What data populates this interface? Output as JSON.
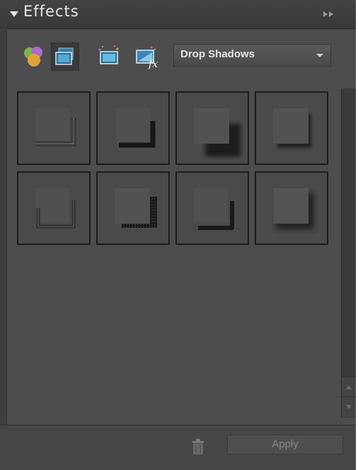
{
  "panel": {
    "title": "Effects",
    "collapse_icon": "double-chevron-right-icon"
  },
  "toolbar": {
    "buttons": [
      {
        "icon": "color-spheres-icon",
        "selected": false
      },
      {
        "icon": "layer-styles-icon",
        "selected": true
      },
      {
        "icon": "photo-effects-icon",
        "selected": false
      },
      {
        "icon": "filters-fx-icon",
        "selected": false
      }
    ],
    "category_select": {
      "value": "Drop Shadows"
    }
  },
  "thumbnails": {
    "count": 8,
    "style": "drop-shadow presets"
  },
  "footer": {
    "apply_label": "Apply",
    "trash_icon": "trash-icon"
  },
  "colors": {
    "panel_bg": "#4d4d4d",
    "title_text": "#e8e8e8",
    "thumb_border": "#1c1c1c"
  }
}
